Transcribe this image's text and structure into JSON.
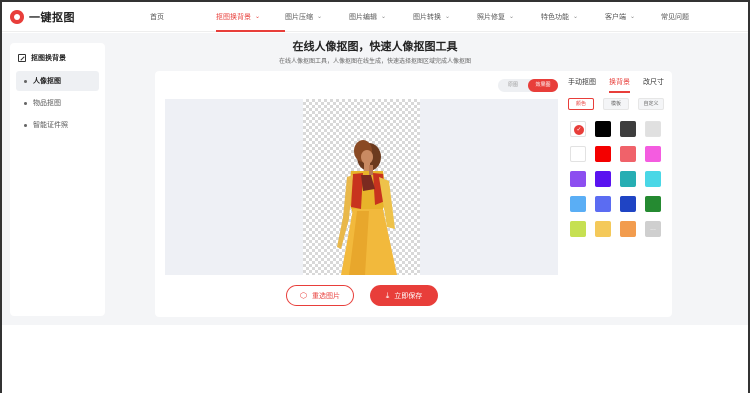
{
  "logo": {
    "text": "一键抠图"
  },
  "nav": [
    {
      "label": "首页",
      "has_menu": false,
      "active": false
    },
    {
      "label": "抠图换背景",
      "has_menu": true,
      "active": true
    },
    {
      "label": "图片压缩",
      "has_menu": true,
      "active": false
    },
    {
      "label": "图片编辑",
      "has_menu": true,
      "active": false
    },
    {
      "label": "图片转换",
      "has_menu": true,
      "active": false
    },
    {
      "label": "照片修复",
      "has_menu": true,
      "active": false
    },
    {
      "label": "特色功能",
      "has_menu": true,
      "active": false
    },
    {
      "label": "客户端",
      "has_menu": true,
      "active": false
    },
    {
      "label": "常见问题",
      "has_menu": false,
      "active": false
    }
  ],
  "sidebar": {
    "heading": "抠图换背景",
    "items": [
      {
        "label": "人像抠图",
        "active": true
      },
      {
        "label": "物品抠图",
        "active": false
      },
      {
        "label": "智能证件照",
        "active": false
      }
    ]
  },
  "main": {
    "title": "在线人像抠图，快速人像抠图工具",
    "subtitle": "在线人像抠图工具，人像抠图在线生成，快速选择抠图区域完成人像抠图"
  },
  "view_toggle": {
    "left": "原图",
    "right": "效果图",
    "active": "right"
  },
  "panel": {
    "tabs": [
      {
        "label": "手动抠图",
        "active": false
      },
      {
        "label": "换背景",
        "active": true
      },
      {
        "label": "改尺寸",
        "active": false
      }
    ],
    "subtabs": [
      {
        "label": "颜色",
        "active": true
      },
      {
        "label": "模板",
        "active": false
      },
      {
        "label": "自定义",
        "active": false
      }
    ],
    "swatches": [
      "transparent",
      "#000000",
      "#3d3d3d",
      "#e0e0e0",
      "#ffffff",
      "#f40000",
      "#f0626a",
      "#f45ce0",
      "#8c4ef0",
      "#5a13f0",
      "#26aeb3",
      "#4ad7e6",
      "#5aaef5",
      "#5b6cf2",
      "#1f44c4",
      "#258a31",
      "#c6e052",
      "#f4c95a",
      "#f29c4e",
      "#cfcfcf"
    ],
    "selected_swatch": 0,
    "more_label": "..."
  },
  "buttons": {
    "reselect": "重选图片",
    "save": "立即保存"
  },
  "colors": {
    "accent": "#e83e3a",
    "page_bg": "#f4f5f7"
  },
  "icons": {
    "reselect": "hexagon-icon",
    "save": "download-icon",
    "selected": "check-icon"
  }
}
